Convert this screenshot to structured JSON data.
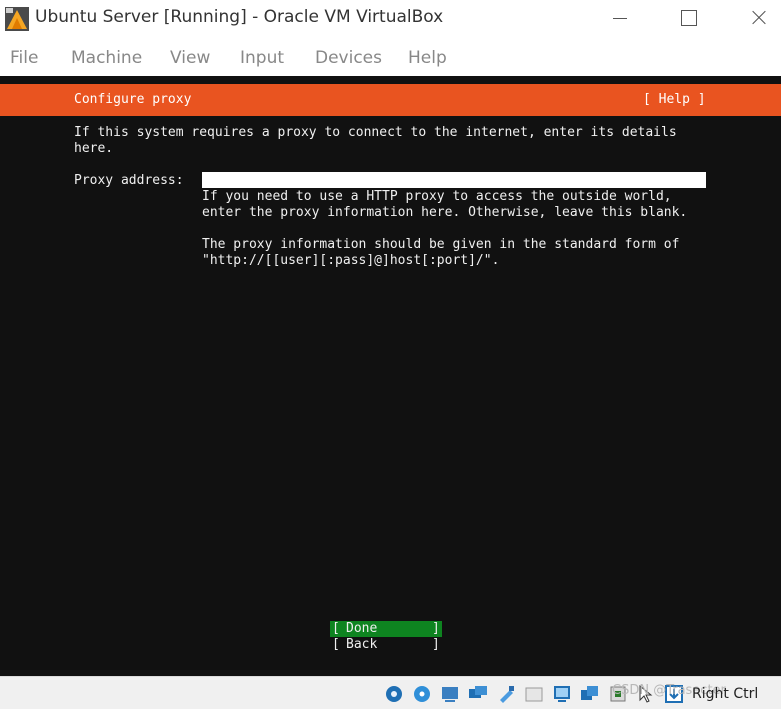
{
  "window": {
    "title": "Ubuntu Server [Running] - Oracle VM VirtualBox",
    "app_icon": "virtualbox-icon",
    "controls": [
      "minimize-icon",
      "maximize-icon",
      "close-icon"
    ]
  },
  "menu": {
    "items": [
      "File",
      "Machine",
      "View",
      "Input",
      "Devices",
      "Help"
    ]
  },
  "installer": {
    "accent_color": "#e95420",
    "header": {
      "title": "Configure proxy",
      "help": "[ Help ]"
    },
    "intro_lines": [
      "If this system requires a proxy to connect to the internet, enter its details",
      "here."
    ],
    "proxy": {
      "label": "Proxy address:",
      "value": "",
      "help_lines": [
        "If you need to use a HTTP proxy to access the outside world,",
        "enter the proxy information here. Otherwise, leave this blank.",
        "The proxy information should be given in the standard form of",
        "\"http://[[user][:pass]@]host[:port]/\"."
      ]
    },
    "buttons": {
      "open_bracket": "[",
      "close_bracket": "]",
      "done": "Done",
      "back": "Back",
      "done_color": "#0e8420"
    }
  },
  "statusbar": {
    "icons": [
      "hard-disk-icon",
      "optical-drive-icon",
      "audio-icon",
      "network-icon",
      "usb-icon",
      "shared-folders-icon",
      "display-icon",
      "recording-icon",
      "cpu-icon",
      "mouse-integration-icon",
      "keyboard-capture-icon"
    ],
    "watermark": "CSDN @Trasecter",
    "host_key": "Right Ctrl"
  }
}
